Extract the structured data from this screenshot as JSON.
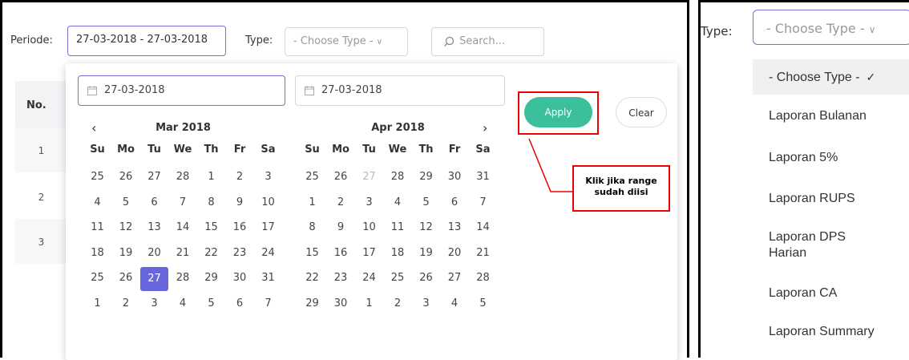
{
  "filter": {
    "periode_label": "Periode:",
    "periode_value": "27-03-2018 - 27-03-2018",
    "type_label": "Type:",
    "type_value": "- Choose Type -",
    "search_placeholder": "Search..."
  },
  "table": {
    "header_no": "No.",
    "rows": [
      "1",
      "2",
      "3"
    ]
  },
  "datepicker": {
    "start_date": "27-03-2018",
    "end_date": "27-03-2018",
    "apply_label": "Apply",
    "clear_label": "Clear",
    "weekdays": [
      "Su",
      "Mo",
      "Tu",
      "We",
      "Th",
      "Fr",
      "Sa"
    ],
    "left_month": {
      "title": "Mar 2018",
      "weeks": [
        [
          "25",
          "26",
          "27",
          "28",
          "1",
          "2",
          "3"
        ],
        [
          "4",
          "5",
          "6",
          "7",
          "8",
          "9",
          "10"
        ],
        [
          "11",
          "12",
          "13",
          "14",
          "15",
          "16",
          "17"
        ],
        [
          "18",
          "19",
          "20",
          "21",
          "22",
          "23",
          "24"
        ],
        [
          "25",
          "26",
          "27",
          "28",
          "29",
          "30",
          "31"
        ],
        [
          "1",
          "2",
          "3",
          "4",
          "5",
          "6",
          "7"
        ]
      ],
      "selected": "27"
    },
    "right_month": {
      "title": "Apr 2018",
      "weeks": [
        [
          "25",
          "26",
          "27",
          "28",
          "29",
          "30",
          "31"
        ],
        [
          "1",
          "2",
          "3",
          "4",
          "5",
          "6",
          "7"
        ],
        [
          "8",
          "9",
          "10",
          "11",
          "12",
          "13",
          "14"
        ],
        [
          "15",
          "16",
          "17",
          "18",
          "19",
          "20",
          "21"
        ],
        [
          "22",
          "23",
          "24",
          "25",
          "26",
          "27",
          "28"
        ],
        [
          "29",
          "30",
          "1",
          "2",
          "3",
          "4",
          "5"
        ]
      ]
    }
  },
  "annotation": {
    "callout_text": "Klik jika range sudah diisi",
    "color": "#e00000"
  },
  "type_dropdown": {
    "label": "Type:",
    "value": "- Choose Type -",
    "options": [
      "- Choose Type -",
      "Laporan Bulanan",
      "Laporan 5%",
      "Laporan RUPS",
      "Laporan DPS Harian",
      "Laporan CA",
      "Laporan Summary"
    ]
  },
  "colors": {
    "accent": "#6866dd",
    "apply_green": "#3bbf9c"
  }
}
